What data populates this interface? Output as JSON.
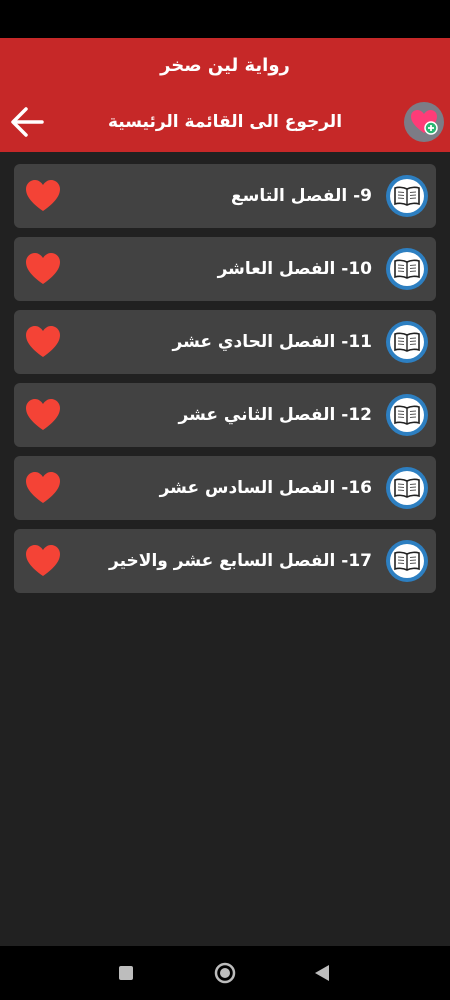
{
  "app_bar": {
    "title": "رواية لين صخر"
  },
  "sub_bar": {
    "title": "الرجوع الى القائمة الرئيسية"
  },
  "chapters": [
    {
      "label": "9- الفصل التاسع"
    },
    {
      "label": "10- الفصل العاشر"
    },
    {
      "label": "11- الفصل الحادي عشر"
    },
    {
      "label": "12- الفصل الثاني عشر"
    },
    {
      "label": "16- الفصل السادس عشر"
    },
    {
      "label": "17- الفصل السابع عشر والاخير"
    }
  ],
  "colors": {
    "primary": "#c62828",
    "background": "#212121",
    "row_background": "#424242",
    "heart": "#f44336",
    "book_ring": "#2d7fc1"
  },
  "icons": {
    "back": "arrow-left-icon",
    "favorites": "heart-badge-icon",
    "book": "open-book-icon",
    "heart": "heart-icon",
    "nav_recents": "square-icon",
    "nav_home": "circle-icon",
    "nav_back": "triangle-back-icon"
  }
}
